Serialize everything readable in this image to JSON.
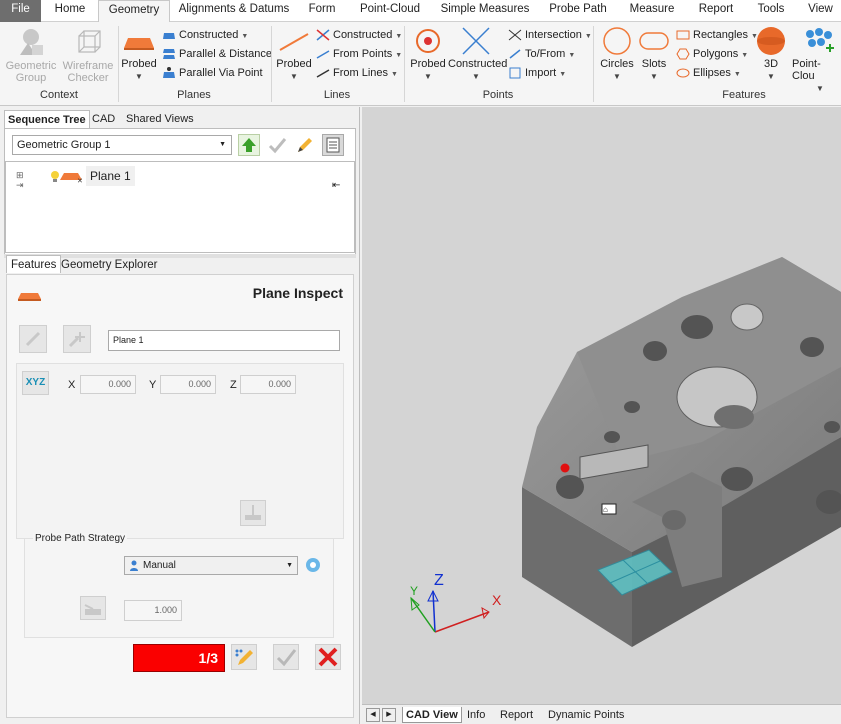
{
  "menu": {
    "tabs": [
      "File",
      "Home",
      "Geometry",
      "Alignments & Datums",
      "Form",
      "Point-Cloud",
      "Simple Measures",
      "Probe Path",
      "Measure",
      "Report",
      "Tools",
      "View"
    ],
    "active": "Geometry"
  },
  "ribbon": {
    "context": {
      "label": "Context",
      "geometric_group": "Geometric Group",
      "wireframe_checker": "Wireframe Checker"
    },
    "planes": {
      "label": "Planes",
      "probed": "Probed",
      "constructed": "Constructed",
      "parallel_distance": "Parallel & Distance",
      "parallel_via_point": "Parallel Via Point"
    },
    "lines": {
      "label": "Lines",
      "probed": "Probed",
      "constructed": "Constructed",
      "from_points": "From Points",
      "from_lines": "From Lines"
    },
    "points": {
      "label": "Points",
      "probed": "Probed",
      "constructed": "Constructed",
      "intersection": "Intersection",
      "to_from": "To/From",
      "import": "Import"
    },
    "features": {
      "label": "Features",
      "circles": "Circles",
      "slots": "Slots",
      "rectangles": "Rectangles",
      "polygons": "Polygons",
      "ellipses": "Ellipses",
      "threed": "3D",
      "point_cloud": "Point-Clou"
    }
  },
  "left": {
    "tabs": [
      "Sequence Tree",
      "CAD",
      "Shared Views"
    ],
    "group_select": "Geometric Group 1",
    "tree_item": "Plane 1",
    "subtabs": [
      "Features",
      "Geometry Explorer"
    ],
    "feature_title": "Plane Inspect",
    "name_value": "Plane 1",
    "xyz_label": "XYZ",
    "x_label": "X",
    "x_value": "0.000",
    "y_label": "Y",
    "y_value": "0.000",
    "z_label": "Z",
    "z_value": "0.000",
    "strategy_label": "Probe Path Strategy",
    "strategy_value": "Manual",
    "offset_value": "1.000",
    "progress": "1/3"
  },
  "cad_tabs": [
    "CAD View",
    "Info",
    "Report",
    "Dynamic Points"
  ],
  "axes": {
    "x": "X",
    "y": "Y",
    "z": "Z"
  },
  "colors": {
    "accent": "#ff0000",
    "highlight": "#5ec6c8",
    "part": "#8c8c8c"
  }
}
